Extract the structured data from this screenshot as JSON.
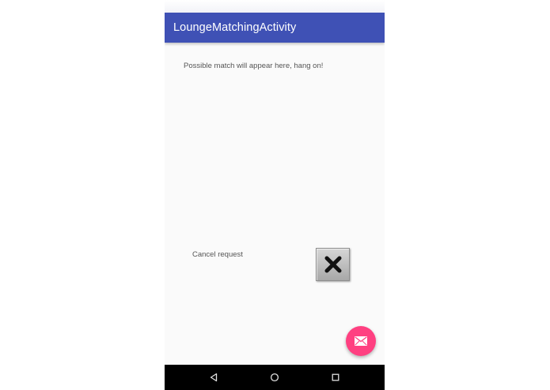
{
  "app_bar": {
    "title": "LoungeMatchingActivity"
  },
  "main": {
    "match_status_text": "Possible match will appear here, hang on!",
    "cancel_label": "Cancel request"
  },
  "icons": {
    "cancel_button": "close-x-icon",
    "fab": "email-icon",
    "nav_back": "back-triangle-icon",
    "nav_home": "home-circle-icon",
    "nav_recents": "recents-square-icon"
  },
  "colors": {
    "primary": "#3f51b5",
    "accent": "#ff4081",
    "background": "#fafafa",
    "nav_bar": "#000000"
  }
}
